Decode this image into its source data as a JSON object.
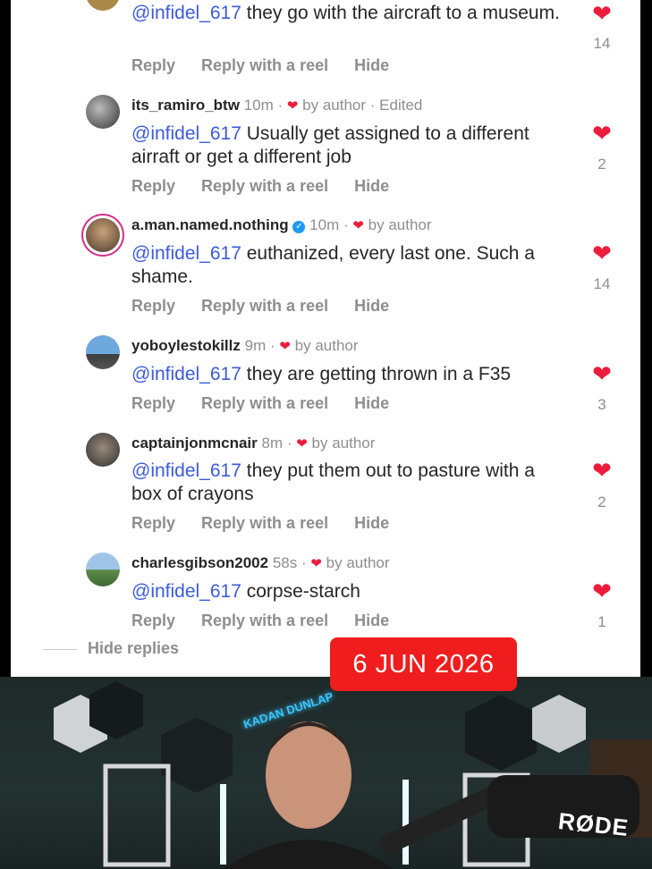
{
  "comments": [
    {
      "username": "",
      "time": "",
      "author_like": "",
      "edited": "",
      "mention": "@infidel_617",
      "text": " they go with the aircraft to a museum.",
      "likes": "14"
    },
    {
      "username": "its_ramiro_btw",
      "time": "10m",
      "author_like": "by author",
      "edited": "· Edited",
      "mention": "@infidel_617",
      "text": " Usually get assigned to a different airraft or get a different job",
      "likes": "2"
    },
    {
      "username": "a.man.named.nothing",
      "time": "10m",
      "author_like": "by author",
      "edited": "",
      "mention": "@infidel_617",
      "text": " euthanized, every last one. Such a shame.",
      "likes": "14"
    },
    {
      "username": "yoboylestokillz",
      "time": "9m",
      "author_like": "by author",
      "edited": "",
      "mention": "@infidel_617",
      "text": " they are getting thrown in a  F35",
      "likes": "3"
    },
    {
      "username": "captainjonmcnair",
      "time": "8m",
      "author_like": "by author",
      "edited": "",
      "mention": "@infidel_617",
      "text": " they put them out to pasture with a box of crayons",
      "likes": "2"
    },
    {
      "username": "charlesgibson2002",
      "time": "58s",
      "author_like": "by author",
      "edited": "",
      "mention": "@infidel_617",
      "text": " corpse-starch",
      "likes": "1"
    }
  ],
  "actions": {
    "reply": "Reply",
    "reply_reel": "Reply with a reel",
    "hide": "Hide"
  },
  "hide_replies": "Hide replies",
  "date_badge": "6 JUN 2026",
  "video": {
    "neon_sign": "KADAN DUNLAP",
    "mic_brand": "RØDE"
  },
  "colors": {
    "like_red": "#ed1c3b",
    "mention_blue": "#3b5bdb",
    "badge_red": "#ef1d1d"
  },
  "icons": [
    "heart-icon",
    "verified-badge-icon"
  ]
}
